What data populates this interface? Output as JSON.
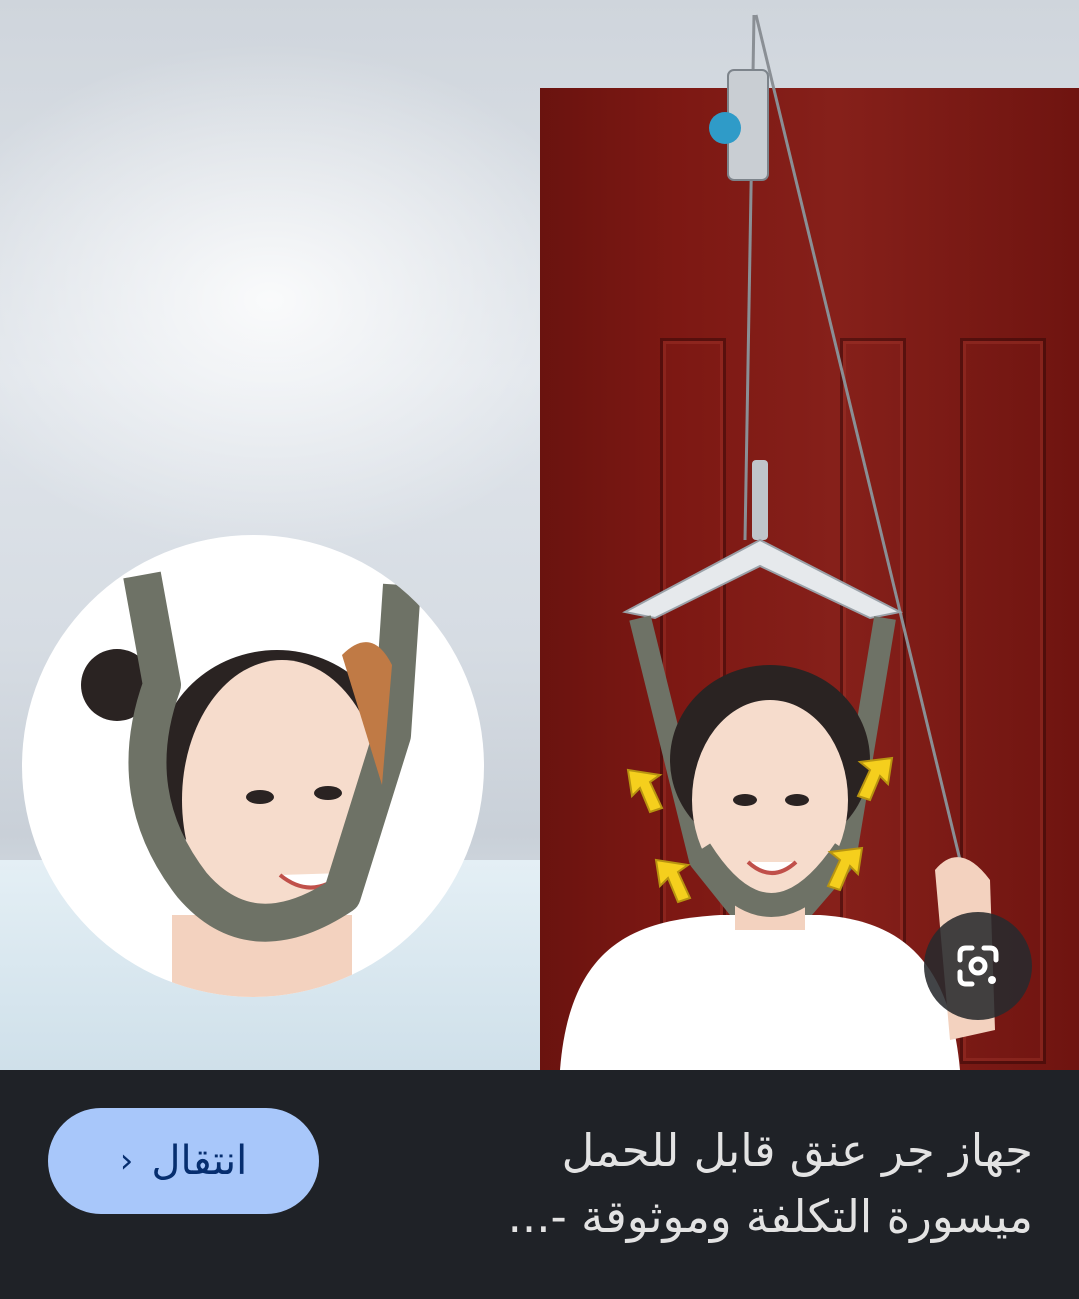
{
  "image": {
    "description_icons": [
      "neck-traction-photo",
      "lens-search-icon"
    ]
  },
  "result": {
    "title_line1": "جهاز جر عنق قابل للحمل",
    "title_line2": "ميسورة التكلفة وموثوقة -...",
    "visit_label": "انتقال",
    "subtitle": ""
  },
  "colors": {
    "sheet_background": "#1f2227",
    "button_background": "#a8c7fa",
    "button_text": "#062e6f",
    "title_text": "#e3e3e3"
  }
}
